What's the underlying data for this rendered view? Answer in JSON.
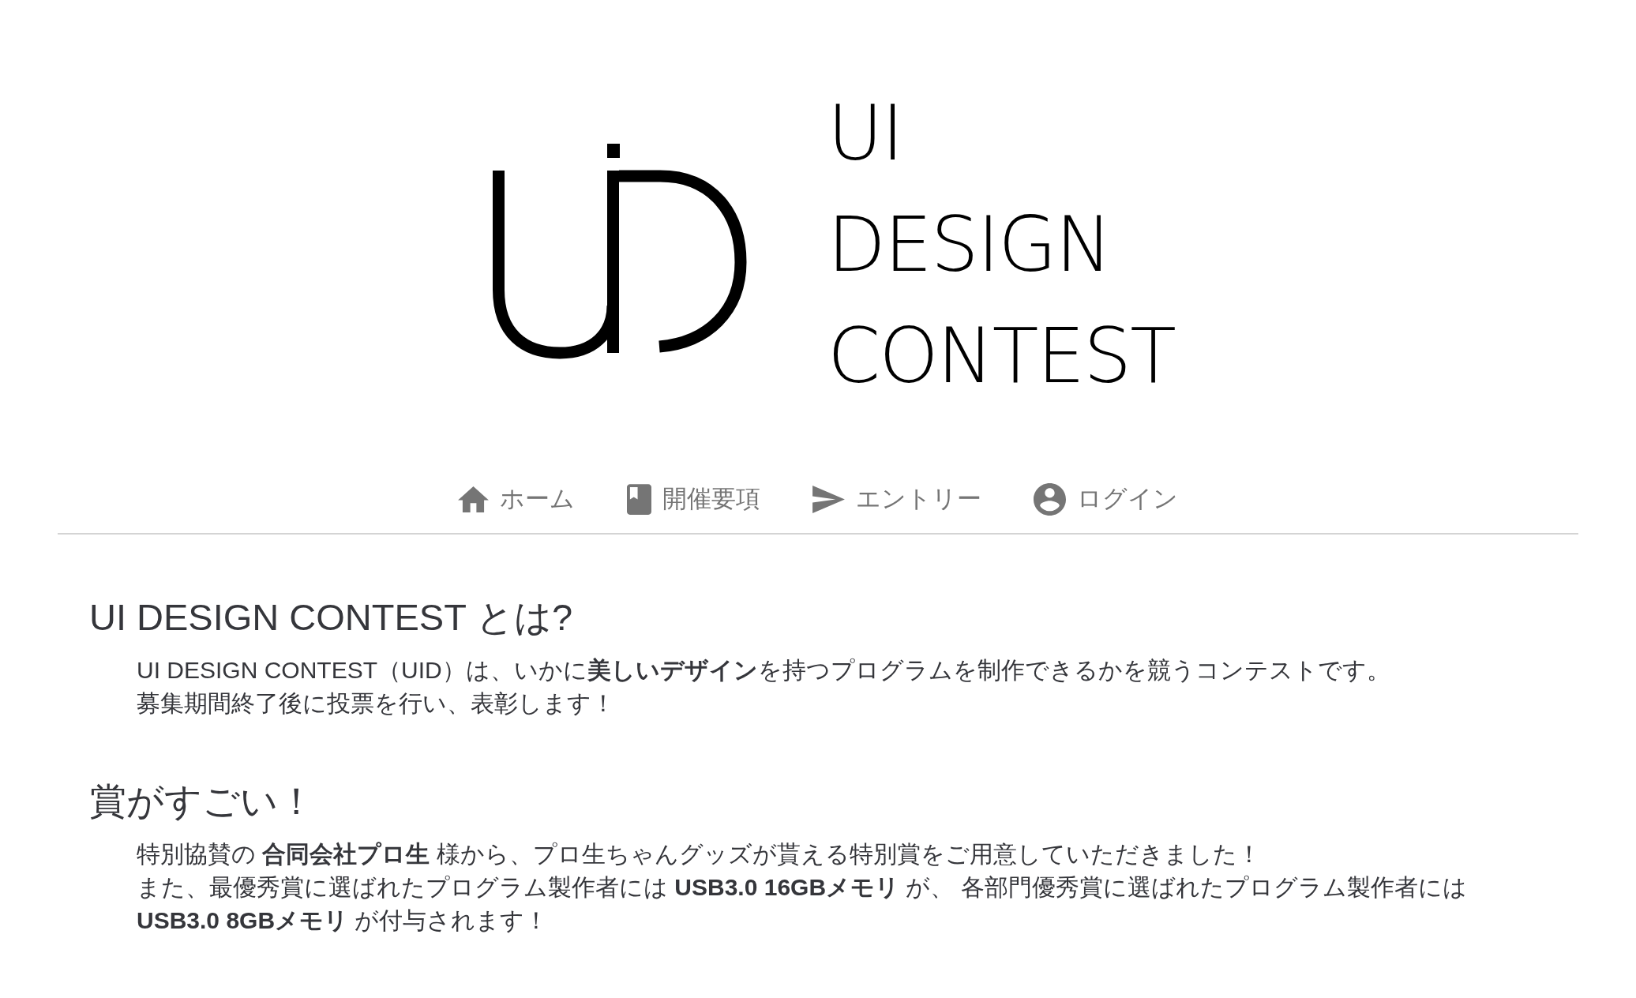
{
  "logo": {
    "lines": [
      "UI",
      "DESIGN",
      "CONTEST"
    ]
  },
  "nav": [
    {
      "label": "ホーム"
    },
    {
      "label": "開催要項"
    },
    {
      "label": "エントリー"
    },
    {
      "label": "ログイン"
    }
  ],
  "sections": [
    {
      "heading": "UI DESIGN CONTEST とは?",
      "lines": [
        "UI DESIGN CONTEST（UID）は、いかに**美しいデザイン**を持つプログラムを制作できるかを競うコンテストです。",
        "募集期間終了後に投票を行い、表彰します！"
      ]
    },
    {
      "heading": "賞がすごい！",
      "lines": [
        "特別協賛の **合同会社プロ生** 様から、プロ生ちゃんグッズが貰える特別賞をご用意していただきました！",
        "また、最優秀賞に選ばれたプログラム製作者には **USB3.0 16GBメモリ** が、 各部門優秀賞に選ばれたプログラム製作者には",
        "**USB3.0 8GBメモリ** が付与されます！"
      ]
    }
  ]
}
